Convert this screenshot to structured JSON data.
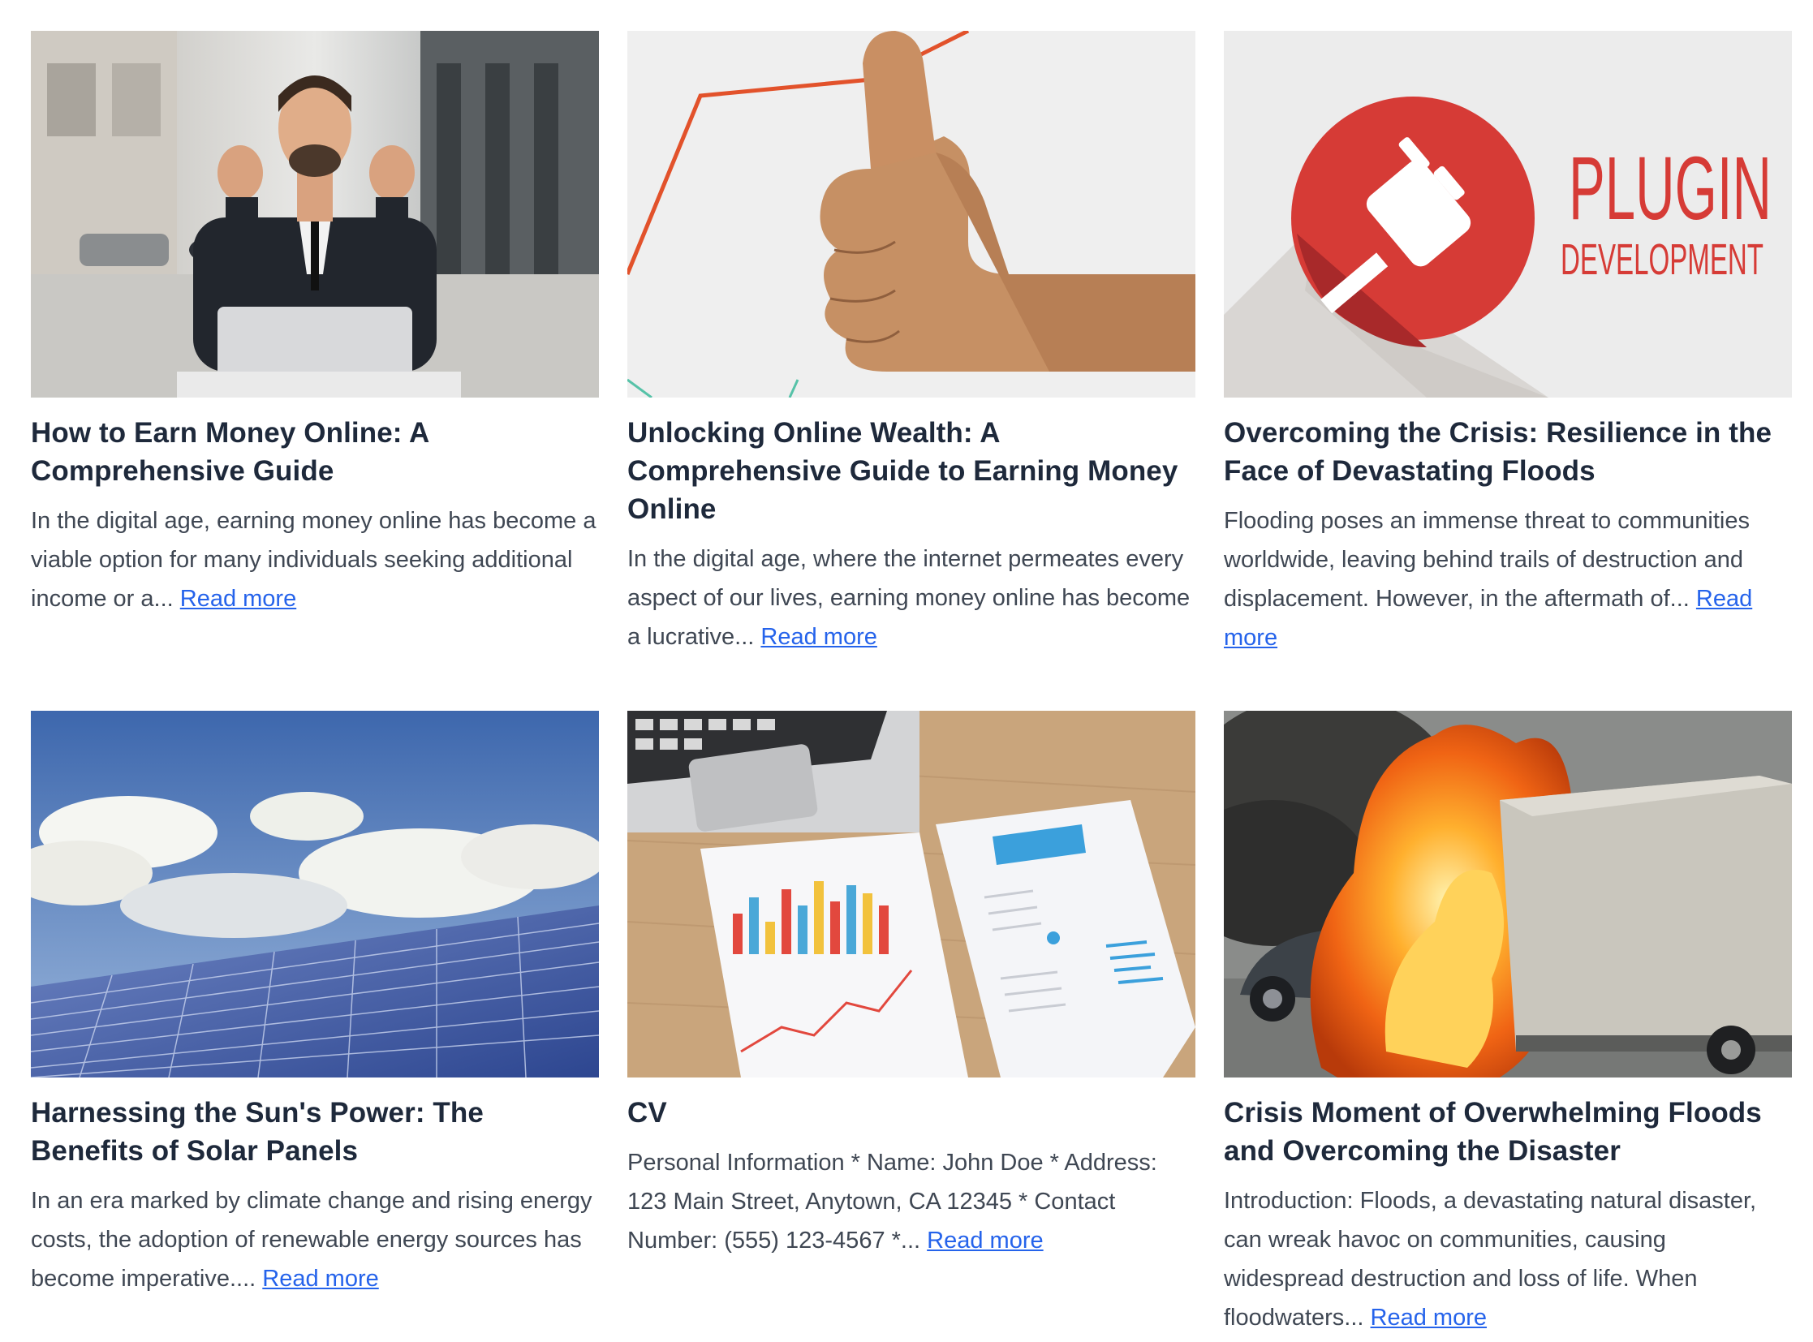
{
  "posts": [
    {
      "title": "How to Earn Money Online: A Comprehensive Guide",
      "excerpt": "In the digital age, earning money online has become a viable option for many individuals seeking additional income or a...",
      "read_more": "Read more",
      "image_icon": "businessman-laptop-image"
    },
    {
      "title": "Unlocking Online Wealth: A Comprehensive Guide to Earning Money Online",
      "excerpt": "In the digital age, where the internet permeates every aspect of our lives, earning money online has become a lucrative...",
      "read_more": "Read more",
      "image_icon": "thumbs-up-image"
    },
    {
      "title": "Overcoming the Crisis: Resilience in the Face of Devastating Floods",
      "excerpt": "Flooding poses an immense threat to communities worldwide, leaving behind trails of destruction and displacement. However, in the aftermath of...",
      "read_more": "Read more",
      "image_icon": "plugin-development-image",
      "image_text": [
        "PLUGIN",
        "DEVELOPMENT"
      ]
    },
    {
      "title": "Harnessing the Sun's Power: The Benefits of Solar Panels",
      "excerpt": "In an era marked by climate change and rising energy costs, the adoption of renewable energy sources has become imperative....",
      "read_more": "Read more",
      "image_icon": "solar-panels-image"
    },
    {
      "title": "CV",
      "excerpt": "Personal Information * Name: John Doe * Address: 123 Main Street, Anytown, CA 12345 * Contact Number: (555) 123-4567 *...",
      "read_more": "Read more",
      "image_icon": "resume-laptop-image"
    },
    {
      "title": "Crisis Moment of Overwhelming Floods and Overcoming the Disaster",
      "excerpt": "Introduction: Floods, a devastating natural disaster, can wreak havoc on communities, causing widespread destruction and loss of life. When floodwaters...",
      "read_more": "Read more",
      "image_icon": "burning-truck-image"
    }
  ],
  "colors": {
    "link": "#2563eb",
    "title": "#1e293b",
    "text": "#3f4753",
    "plugin_red": "#d63b36"
  }
}
